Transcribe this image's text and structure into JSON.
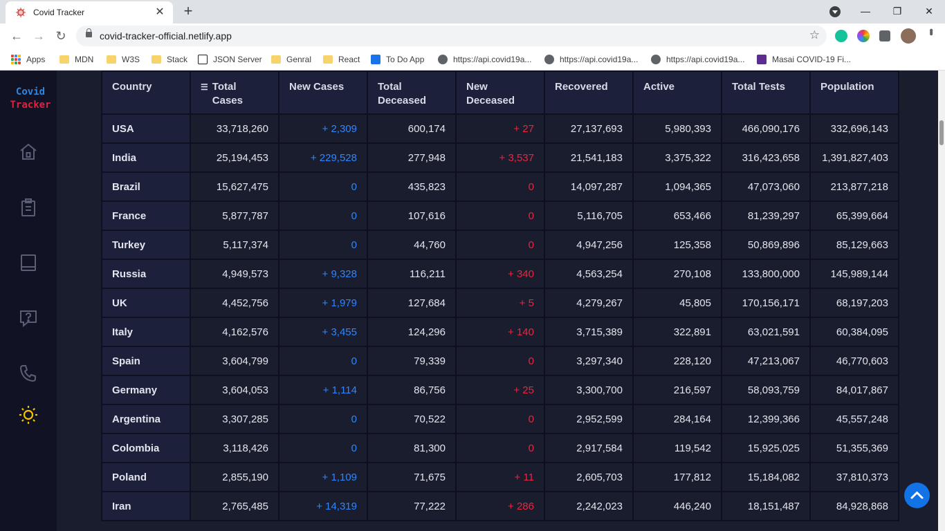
{
  "browser": {
    "tab_title": "Covid Tracker",
    "url": "covid-tracker-official.netlify.app",
    "bookmarks": [
      "Apps",
      "MDN",
      "W3S",
      "Stack",
      "JSON Server",
      "Genral",
      "React",
      "To Do App",
      "https://api.covid19a...",
      "https://api.covid19a...",
      "https://api.covid19a...",
      "Masai COVID-19 Fi..."
    ]
  },
  "app": {
    "logo_line1": "Covid",
    "logo_line2": "Tracker"
  },
  "table": {
    "headers": [
      "Country",
      "Total Cases",
      "New Cases",
      "Total Deceased",
      "New Deceased",
      "Recovered",
      "Active",
      "Total Tests",
      "Population"
    ],
    "header_lines": [
      [
        "Country"
      ],
      [
        "Total",
        "Cases"
      ],
      [
        "New Cases"
      ],
      [
        "Total",
        "Deceased"
      ],
      [
        "New",
        "Deceased"
      ],
      [
        "Recovered"
      ],
      [
        "Active"
      ],
      [
        "Total Tests"
      ],
      [
        "Population"
      ]
    ],
    "rows": [
      [
        "USA",
        "33,718,260",
        "+ 2,309",
        "600,174",
        "+ 27",
        "27,137,693",
        "5,980,393",
        "466,090,176",
        "332,696,143"
      ],
      [
        "India",
        "25,194,453",
        "+ 229,528",
        "277,948",
        "+ 3,537",
        "21,541,183",
        "3,375,322",
        "316,423,658",
        "1,391,827,403"
      ],
      [
        "Brazil",
        "15,627,475",
        "0",
        "435,823",
        "0",
        "14,097,287",
        "1,094,365",
        "47,073,060",
        "213,877,218"
      ],
      [
        "France",
        "5,877,787",
        "0",
        "107,616",
        "0",
        "5,116,705",
        "653,466",
        "81,239,297",
        "65,399,664"
      ],
      [
        "Turkey",
        "5,117,374",
        "0",
        "44,760",
        "0",
        "4,947,256",
        "125,358",
        "50,869,896",
        "85,129,663"
      ],
      [
        "Russia",
        "4,949,573",
        "+ 9,328",
        "116,211",
        "+ 340",
        "4,563,254",
        "270,108",
        "133,800,000",
        "145,989,144"
      ],
      [
        "UK",
        "4,452,756",
        "+ 1,979",
        "127,684",
        "+ 5",
        "4,279,267",
        "45,805",
        "170,156,171",
        "68,197,203"
      ],
      [
        "Italy",
        "4,162,576",
        "+ 3,455",
        "124,296",
        "+ 140",
        "3,715,389",
        "322,891",
        "63,021,591",
        "60,384,095"
      ],
      [
        "Spain",
        "3,604,799",
        "0",
        "79,339",
        "0",
        "3,297,340",
        "228,120",
        "47,213,067",
        "46,770,603"
      ],
      [
        "Germany",
        "3,604,053",
        "+ 1,114",
        "86,756",
        "+ 25",
        "3,300,700",
        "216,597",
        "58,093,759",
        "84,017,867"
      ],
      [
        "Argentina",
        "3,307,285",
        "0",
        "70,522",
        "0",
        "2,952,599",
        "284,164",
        "12,399,366",
        "45,557,248"
      ],
      [
        "Colombia",
        "3,118,426",
        "0",
        "81,300",
        "0",
        "2,917,584",
        "119,542",
        "15,925,025",
        "51,355,369"
      ],
      [
        "Poland",
        "2,855,190",
        "+ 1,109",
        "71,675",
        "+ 11",
        "2,605,703",
        "177,812",
        "15,184,082",
        "37,810,373"
      ],
      [
        "Iran",
        "2,765,485",
        "+ 14,319",
        "77,222",
        "+ 286",
        "2,242,023",
        "446,240",
        "18,151,487",
        "84,928,868"
      ]
    ]
  },
  "colors": {
    "new_cases": "#2f86ff",
    "new_deceased": "#e8263f",
    "theme_icon": "#f5c400"
  }
}
